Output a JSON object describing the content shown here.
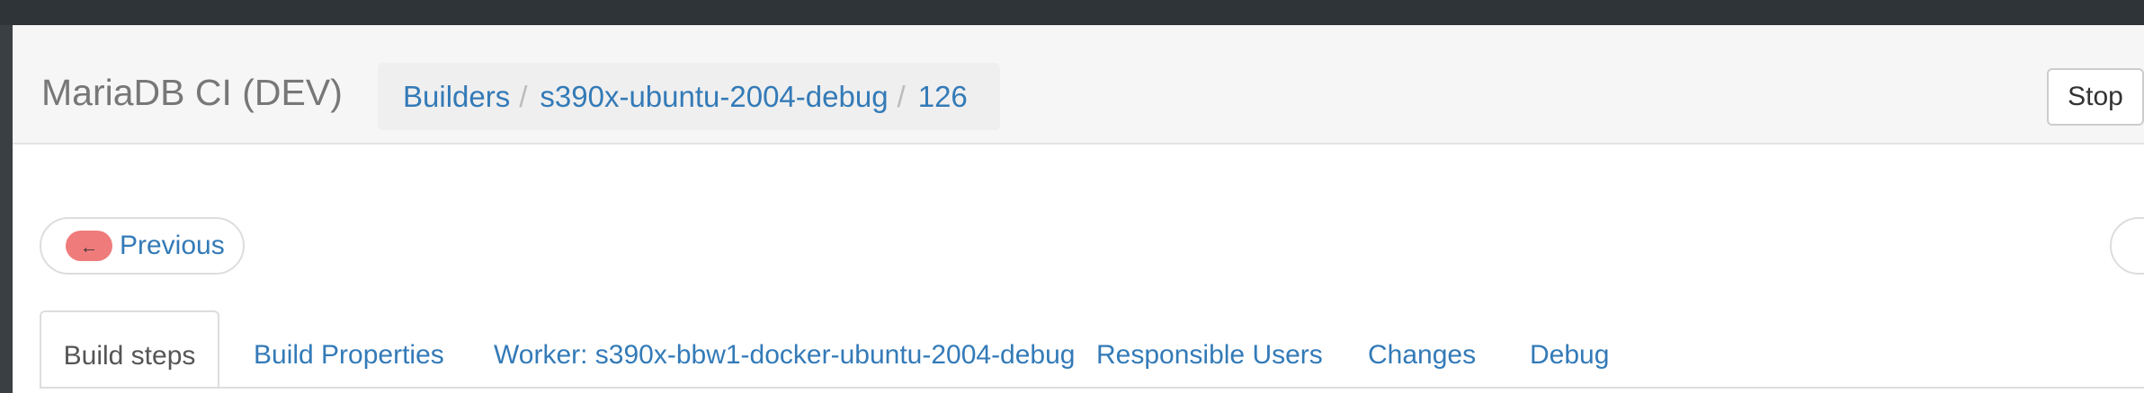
{
  "navbar": {
    "brand": "MariaDB CI (DEV)",
    "breadcrumb": [
      "Builders",
      "s390x-ubuntu-2004-debug",
      "126"
    ],
    "separator": "/",
    "stop_label": "Stop"
  },
  "pager": {
    "previous_icon": "←",
    "previous_label": "Previous"
  },
  "tabs": [
    {
      "label": "Build steps",
      "active": true
    },
    {
      "label": "Build Properties"
    },
    {
      "label": "Worker: s390x-bbw1-docker-ubuntu-2004-debug"
    },
    {
      "label": "Responsible Users"
    },
    {
      "label": "Changes"
    },
    {
      "label": "Debug"
    }
  ],
  "colors": {
    "link": "#337ab7",
    "badge_previous": "#ef7b7b",
    "navbar_bg": "#f6f6f6"
  }
}
